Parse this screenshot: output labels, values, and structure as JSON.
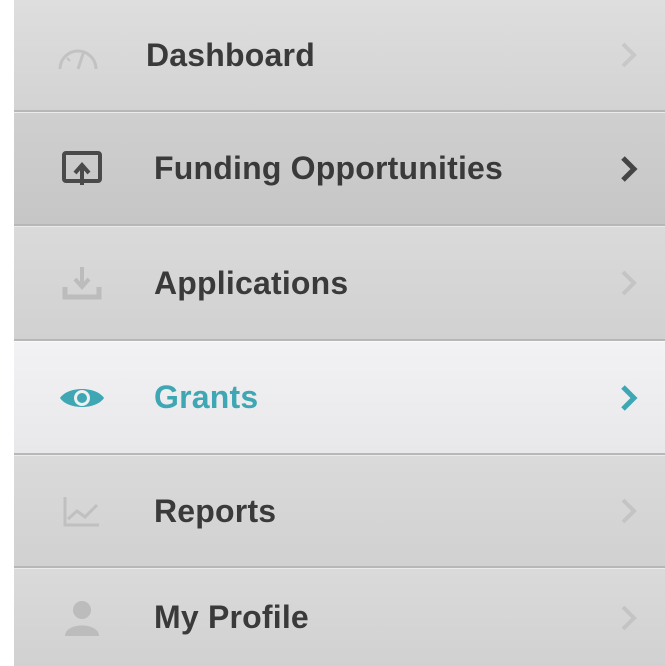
{
  "menu": {
    "items": [
      {
        "label": "Dashboard",
        "icon": "speedometer-icon",
        "state": "normal"
      },
      {
        "label": "Funding Opportunities",
        "icon": "upload-tray-icon",
        "state": "normal"
      },
      {
        "label": "Applications",
        "icon": "download-tray-icon",
        "state": "normal"
      },
      {
        "label": "Grants",
        "icon": "eye-icon",
        "state": "active"
      },
      {
        "label": "Reports",
        "icon": "line-chart-icon",
        "state": "normal"
      },
      {
        "label": "My Profile",
        "icon": "user-icon",
        "state": "normal"
      }
    ]
  },
  "colors": {
    "active_text": "#3fa7b3",
    "text": "#3a3a3a",
    "muted_icon": "#b9b9b9",
    "chevron_muted": "#bdbdbd",
    "chevron_dark": "#444444"
  }
}
